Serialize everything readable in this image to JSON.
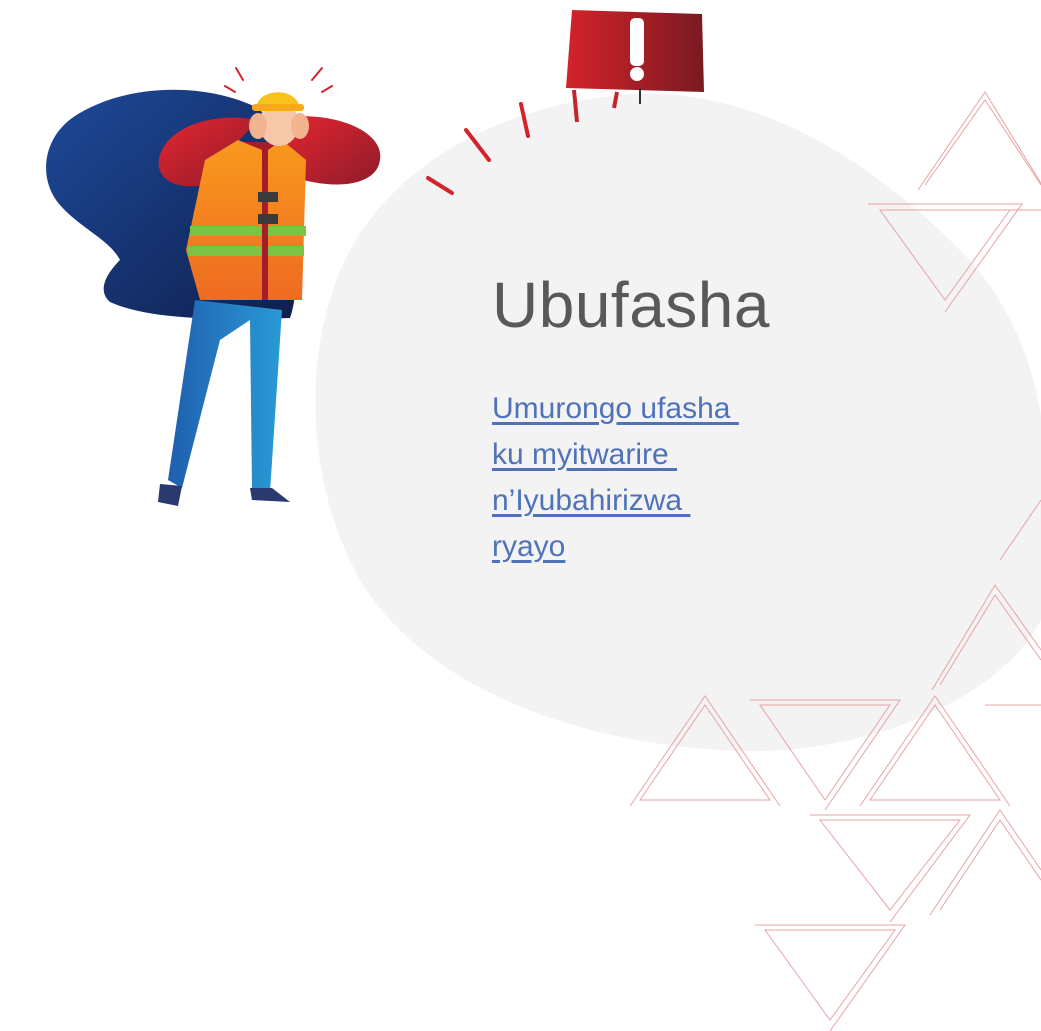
{
  "page": {
    "heading": "Ubufasha",
    "help_link": {
      "lines": [
        "Umurongo ufasha ",
        "ku myitwarire ",
        "n’Iyubahirizwa ",
        "ryayo"
      ]
    }
  },
  "colors": {
    "heading": "#58595b",
    "link": "#4f72b8",
    "blob": "#f3f3f3",
    "triangle_outline": "#e8a3a3",
    "alert_sign": "#c0272d",
    "vest": "#f58220",
    "hair": "#1b3a7a"
  },
  "icons": {
    "alert": "exclamation-sign-icon",
    "illustration": "worker-covering-ears-illustration"
  }
}
